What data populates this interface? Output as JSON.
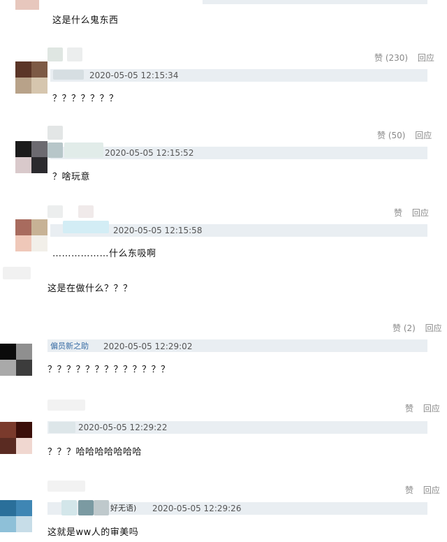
{
  "comments": [
    {
      "text": "这是什么鬼东西",
      "timestamp": "",
      "like": "",
      "reply": ""
    },
    {
      "text": "？？？？？？？",
      "timestamp": "2020-05-05 12:15:34",
      "like": "赞 (230)",
      "reply": "回应"
    },
    {
      "text": "？啥玩意",
      "timestamp": "2020-05-05 12:15:52",
      "like": "赞 (50)",
      "reply": "回应"
    },
    {
      "text": "………………什么东吸啊",
      "timestamp": "2020-05-05 12:15:58",
      "like": "赞",
      "reply": "回应"
    },
    {
      "text": "这是在做什么？？？",
      "timestamp": "",
      "like": "",
      "reply": ""
    },
    {
      "username": "偏员新之助",
      "text": "？？？？？？？？？？？？？",
      "timestamp": "2020-05-05 12:29:02",
      "like": "赞 (2)",
      "reply": "回应"
    },
    {
      "text": "？？？哈哈哈哈哈哈哈",
      "timestamp": "2020-05-05 12:29:22",
      "like": "赞",
      "reply": "回应"
    },
    {
      "username_suffix": "好无语)",
      "text": "这就是ww人的审美吗",
      "timestamp": "2020-05-05 12:29:26",
      "like": "赞",
      "reply": "回应"
    }
  ],
  "colors": {
    "meta_bar": "#e9eef2",
    "timestamp": "#555555",
    "action": "#888888",
    "username": "#3a6ea5"
  }
}
